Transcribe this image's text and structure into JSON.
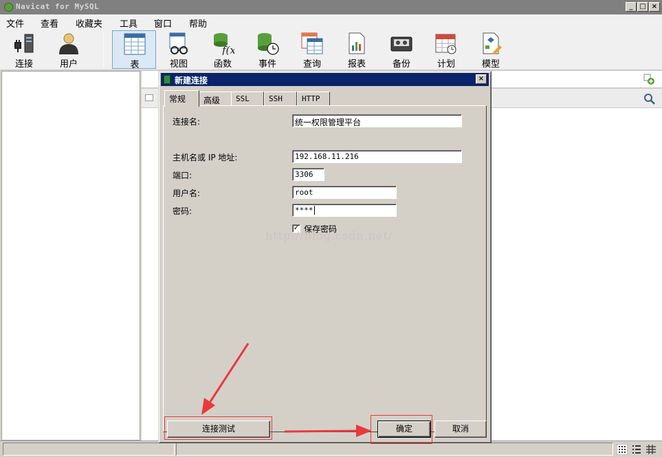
{
  "window": {
    "title": "Navicat for MySQL"
  },
  "menu": [
    "文件",
    "查看",
    "收藏夹",
    "工具",
    "窗口",
    "帮助"
  ],
  "toolbar": {
    "connect": "连接",
    "user": "用户",
    "table": "表",
    "view": "视图",
    "function": "函数",
    "event": "事件",
    "query": "查询",
    "report": "报表",
    "backup": "备份",
    "schedule": "计划",
    "model": "模型"
  },
  "dialog": {
    "title": "新建连接",
    "tabs": [
      "常规",
      "高级",
      "SSL",
      "SSH",
      "HTTP"
    ],
    "labels": {
      "conn_name": "连接名:",
      "host": "主机名或 IP 地址:",
      "port": "端口:",
      "user": "用户名:",
      "password": "密码:",
      "save_password": "保存密码"
    },
    "values": {
      "conn_name": "统一权限管理平台",
      "host": "192.168.11.216",
      "port": "3306",
      "user": "root",
      "password": "****"
    },
    "save_password_checked": true,
    "buttons": {
      "test": "连接测试",
      "ok": "确定",
      "cancel": "取消"
    }
  },
  "watermark": "http://blog.csdn.net/",
  "colors": {
    "title_active": "#0a246a",
    "annotation": "#e83a3a",
    "main_title_inactive": "#808080"
  }
}
